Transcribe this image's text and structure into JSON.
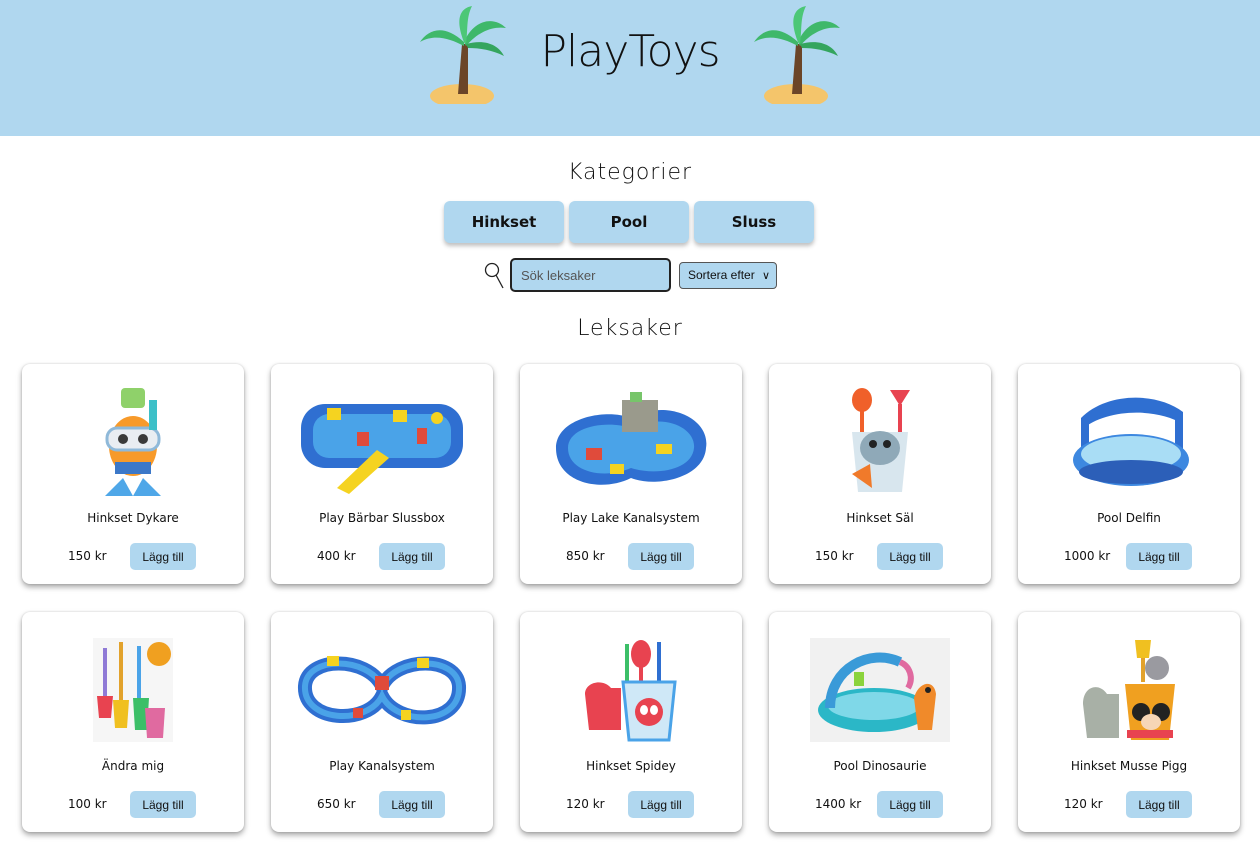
{
  "header": {
    "brand": "PlayToys"
  },
  "categories": {
    "title": "Kategorier",
    "items": [
      {
        "label": "Hinkset"
      },
      {
        "label": "Pool"
      },
      {
        "label": "Sluss"
      }
    ]
  },
  "search": {
    "placeholder": "Sök leksaker",
    "sort_label": "Sortera efter"
  },
  "toys": {
    "title": "Leksaker",
    "add_label": "Lägg till",
    "items": [
      {
        "name": "Hinkset Dykare",
        "price": "150 kr",
        "icon": "diver-bucket-set-icon"
      },
      {
        "name": "Play Bärbar Slussbox",
        "price": "400 kr",
        "icon": "water-lock-box-icon"
      },
      {
        "name": "Play Lake Kanalsystem",
        "price": "850 kr",
        "icon": "canal-system-icon"
      },
      {
        "name": "Hinkset Säl",
        "price": "150 kr",
        "icon": "seal-bucket-set-icon"
      },
      {
        "name": "Pool Delfin",
        "price": "1000 kr",
        "icon": "dolphin-pool-icon"
      },
      {
        "name": "Ändra mig",
        "price": "100 kr",
        "icon": "shovel-rake-set-icon"
      },
      {
        "name": "Play Kanalsystem",
        "price": "650 kr",
        "icon": "canal-track-icon"
      },
      {
        "name": "Hinkset Spidey",
        "price": "120 kr",
        "icon": "spidey-bucket-set-icon"
      },
      {
        "name": "Pool Dinosaurie",
        "price": "1400 kr",
        "icon": "dinosaur-pool-icon"
      },
      {
        "name": "Hinkset Musse Pigg",
        "price": "120 kr",
        "icon": "mickey-bucket-set-icon"
      }
    ]
  }
}
